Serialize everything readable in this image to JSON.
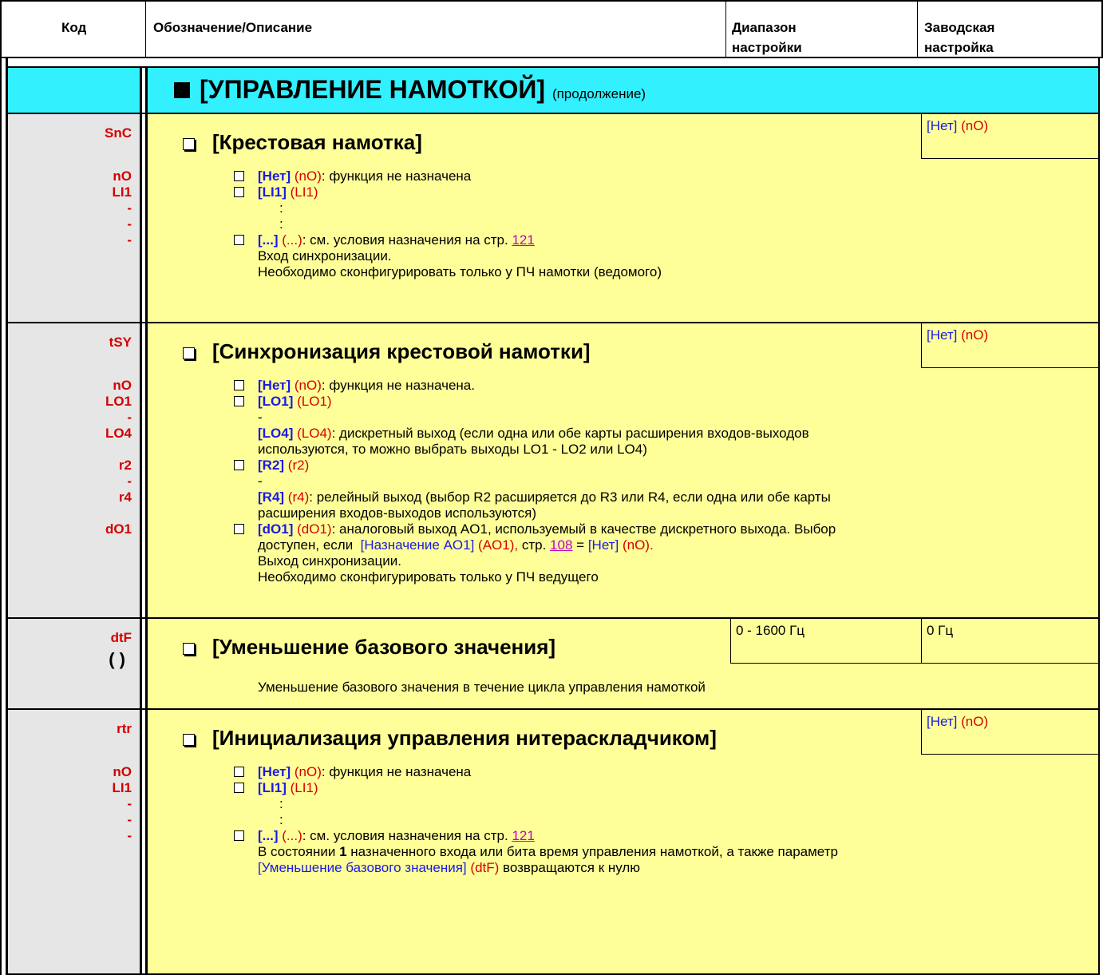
{
  "header": {
    "code": "Код",
    "description": "Обозначение/Описание",
    "range_line1": "Диапазон",
    "range_line2": "настройки",
    "factory_line1": "Заводская",
    "factory_line2": "настройка"
  },
  "section": {
    "title": "[УПРАВЛЕНИЕ НАМОТКОЙ]",
    "continued": "(продолжение)"
  },
  "params": {
    "snc": {
      "code": "SnC",
      "title": "[Крестовая намотка]",
      "factory": "[Нет]",
      "factory_code": "(nO)",
      "codes": [
        "nO",
        "LI1",
        "-",
        "-",
        "-"
      ],
      "opt1_label": "[Нет]",
      "opt1_code": "(nO)",
      "opt1_text": ": функция не назначена",
      "opt2_label": "[LI1]",
      "opt2_code": "(LI1)",
      "dot": ":",
      "opt3_label": "[...]",
      "opt3_code": "(...)",
      "opt3_text": ": см. условия назначения на стр.",
      "opt3_page": "121",
      "note1": "Вход синхронизации.",
      "note2": "Необходимо сконфигурировать только у ПЧ намотки (ведомого)"
    },
    "tsy": {
      "code": "tSY",
      "title": "[Синхронизация крестовой намотки]",
      "factory": "[Нет]",
      "factory_code": "(nO)",
      "codes": [
        "nO",
        "LO1",
        "-",
        "LO4",
        "r2",
        "-",
        "r4",
        "dO1"
      ],
      "o1_label": "[Нет]",
      "o1_code": "(nO)",
      "o1_text": ": функция не назначена.",
      "o2_label": "[LO1]",
      "o2_code": "(LO1)",
      "dash": "-",
      "o3_label": "[LO4]",
      "o3_code": "(LO4)",
      "o3_text": ": дискретный выход (если одна или обе карты расширения входов-выходов",
      "o3_text2": "используются, то можно выбрать выходы LO1 - LO2 или LO4)",
      "o4_label": "[R2]",
      "o4_code": "(r2)",
      "o5_label": "[R4]",
      "o5_code": "(r4)",
      "o5_text": ": релейный выход (выбор R2 расширяется до R3 или R4, если одна или обе карты",
      "o5_text2": "расширения входов-выходов используются)",
      "o6_label": "[dO1]",
      "o6_code": "(dO1)",
      "o6_text": ": аналоговый выход AO1, используемый в качестве дискретного выхода. Выбор",
      "o6_text2a": "доступен, если",
      "o6_ref": "[Назначение AO1]",
      "o6_ref_code": "(AO1),",
      "o6_text2b": "стр.",
      "o6_page": "108",
      "o6_eq": "=",
      "o6_val": "[Нет]",
      "o6_val_code": "(nO).",
      "note1": "Выход синхронизации.",
      "note2": "Необходимо сконфигурировать только у ПЧ ведущего"
    },
    "dtf": {
      "code": "dtF",
      "rot_icon": "rotate-icon",
      "rot_glyph": "( )",
      "title": "[Уменьшение базового значения]",
      "range": "0 - 1600 Гц",
      "factory": "0 Гц",
      "desc": "Уменьшение базового значения в течение цикла управления намоткой"
    },
    "rtr": {
      "code": "rtr",
      "title": "[Инициализация управления нитераскладчиком]",
      "factory": "[Нет]",
      "factory_code": "(nO)",
      "codes": [
        "nO",
        "LI1",
        "-",
        "-",
        "-"
      ],
      "opt1_label": "[Нет]",
      "opt1_code": "(nO)",
      "opt1_text": ": функция не назначена",
      "opt2_label": "[LI1]",
      "opt2_code": "(LI1)",
      "dot": ":",
      "opt3_label": "[...]",
      "opt3_code": "(...)",
      "opt3_text": ": см. условия назначения на стр.",
      "opt3_page": "121",
      "note1a": "В состоянии",
      "note1b": "1",
      "note1c": "назначенного входа или бита время управления намоткой, а также параметр",
      "note2_ref": "[Уменьшение базового значения]",
      "note2_code": "(dtF)",
      "note2_text": "возвращаются  к нулю"
    }
  },
  "colors": {
    "title_bg": "#33f0ff",
    "body_bg": "#ffff99",
    "code_bg": "#e6e6e6",
    "code_text": "#d40000",
    "label_blue": "#1a1ae6",
    "link": "#c000c0"
  }
}
